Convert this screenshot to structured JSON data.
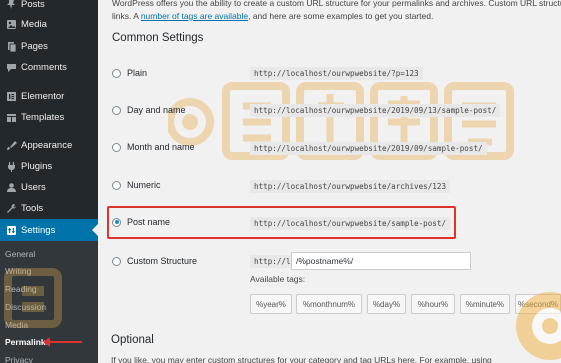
{
  "sidebar": {
    "items": [
      {
        "label": "Posts",
        "icon": "pin-icon"
      },
      {
        "label": "Media",
        "icon": "media-icon"
      },
      {
        "label": "Pages",
        "icon": "pages-icon"
      },
      {
        "label": "Comments",
        "icon": "comments-icon"
      },
      {
        "label": "Elementor",
        "icon": "elementor-icon"
      },
      {
        "label": "Templates",
        "icon": "templates-icon"
      },
      {
        "label": "Appearance",
        "icon": "appearance-icon"
      },
      {
        "label": "Plugins",
        "icon": "plugins-icon"
      },
      {
        "label": "Users",
        "icon": "users-icon"
      },
      {
        "label": "Tools",
        "icon": "tools-icon"
      },
      {
        "label": "Settings",
        "icon": "settings-icon"
      }
    ],
    "submenu": [
      "General",
      "Writing",
      "Reading",
      "Discussion",
      "Media",
      "Permalinks",
      "Privacy"
    ],
    "accent": "#0073aa"
  },
  "intro": {
    "text_before": "WordPress offers you the ability to create a custom URL structure for your permalinks and archives. Custom URL structures ca",
    "text_line2_start": "links. A ",
    "link": "number of tags are available",
    "text_after": ", and here are some examples to get you started."
  },
  "common_settings": {
    "title": "Common Settings",
    "options": [
      {
        "label": "Plain",
        "url": "http://localhost/ourwpwebsite/?p=123",
        "checked": false
      },
      {
        "label": "Day and name",
        "url": "http://localhost/ourwpwebsite/2019/09/13/sample-post/",
        "checked": false
      },
      {
        "label": "Month and name",
        "url": "http://localhost/ourwpwebsite/2019/09/sample-post/",
        "checked": false
      },
      {
        "label": "Numeric",
        "url": "http://localhost/ourwpwebsite/archives/123",
        "checked": false
      },
      {
        "label": "Post name",
        "url": "http://localhost/ourwpwebsite/sample-post/",
        "checked": true
      },
      {
        "label": "Custom Structure",
        "url": "http://localhost/ourwpwebsite",
        "checked": false
      }
    ],
    "custom_value": "/%postname%/",
    "available_tags_label": "Available tags:",
    "tags": [
      "%year%",
      "%monthnum%",
      "%day%",
      "%hour%",
      "%minute%",
      "%second%"
    ]
  },
  "optional": {
    "title": "Optional",
    "text": "If you like, you may enter custom structures for your category and tag URLs here. For example, using"
  },
  "colors": {
    "highlight": "#e0332c"
  }
}
